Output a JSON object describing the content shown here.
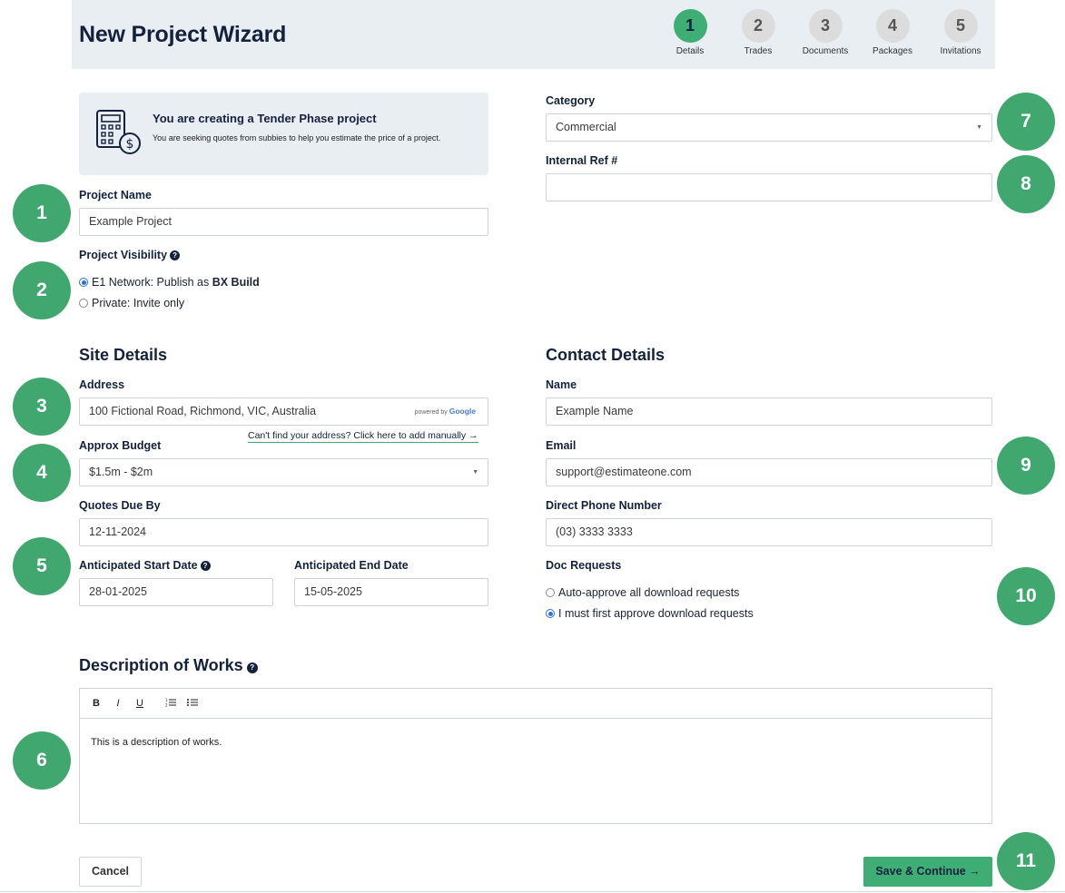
{
  "header": {
    "title": "New Project Wizard",
    "steps": [
      {
        "number": "1",
        "label": "Details",
        "active": true
      },
      {
        "number": "2",
        "label": "Trades",
        "active": false
      },
      {
        "number": "3",
        "label": "Documents",
        "active": false
      },
      {
        "number": "4",
        "label": "Packages",
        "active": false
      },
      {
        "number": "5",
        "label": "Invitations",
        "active": false
      }
    ]
  },
  "badges": [
    "1",
    "2",
    "3",
    "4",
    "5",
    "6",
    "7",
    "8",
    "9",
    "10",
    "11"
  ],
  "info": {
    "icon": "calculator-dollar-icon",
    "title": "You are creating a Tender Phase project",
    "subtitle": "You are seeking quotes from subbies to help you estimate the price of a project."
  },
  "project": {
    "name_label": "Project Name",
    "name_value": "Example Project",
    "visibility_label": "Project Visibility",
    "visibility_option1_prefix": "E1 Network: Publish as ",
    "visibility_option1_bold": "BX Build",
    "visibility_option2": "Private: Invite only"
  },
  "category": {
    "label": "Category",
    "value": "Commercial",
    "internal_ref_label": "Internal Ref #",
    "internal_ref_value": ""
  },
  "site": {
    "title": "Site Details",
    "address_label": "Address",
    "address_value": "100 Fictional Road, Richmond, VIC, Australia",
    "powered_by": "powered by",
    "google": "Google",
    "manual_link": "Can't find your address? Click here to add manually →",
    "budget_label": "Approx Budget",
    "budget_value": "$1.5m - $2m",
    "quotes_due_label": "Quotes Due By",
    "quotes_due_value": "12-11-2024",
    "start_label": "Anticipated Start Date",
    "start_value": "28-01-2025",
    "end_label": "Anticipated End Date",
    "end_value": "15-05-2025"
  },
  "contact": {
    "title": "Contact Details",
    "name_label": "Name",
    "name_placeholder": "Example Name",
    "email_label": "Email",
    "email_value": "support@estimateone.com",
    "phone_label": "Direct Phone Number",
    "phone_value": "(03) 3333 3333",
    "doc_requests_label": "Doc Requests",
    "doc_option1": "Auto-approve all download requests",
    "doc_option2": "I must first approve download requests"
  },
  "description": {
    "title": "Description of Works",
    "toolbar": {
      "bold": "B",
      "italic": "I",
      "underline": "U",
      "ordered": "☰",
      "bullet": "☰"
    },
    "content": "This is a description of works."
  },
  "actions": {
    "cancel": "Cancel",
    "save": "Save & Continue →"
  },
  "colors": {
    "accent": "#3fae74",
    "badge": "#40a86f",
    "navy": "#14213d",
    "panel": "#e9eef3"
  }
}
